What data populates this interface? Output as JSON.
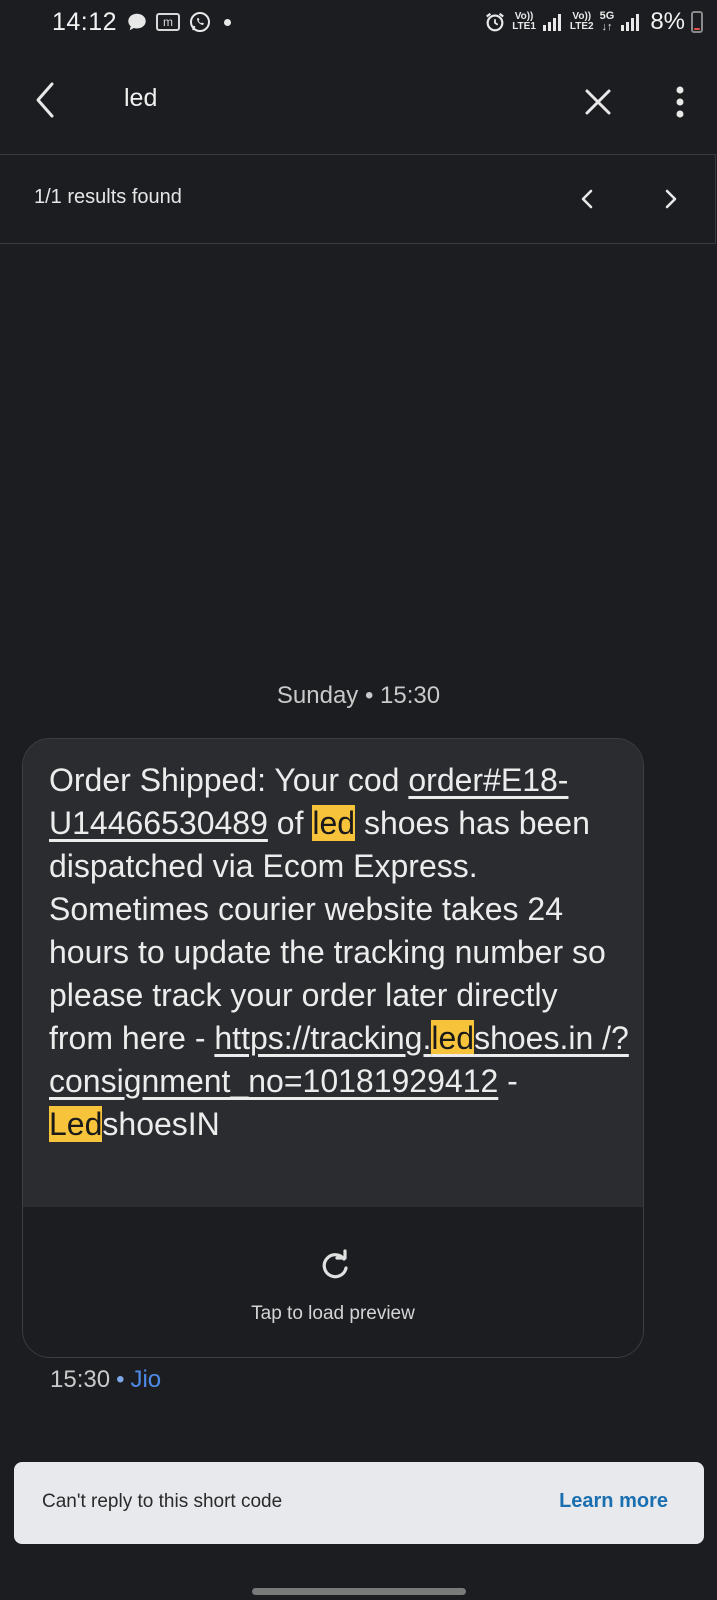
{
  "status_bar": {
    "time": "14:12",
    "msgm_label": "m",
    "net1_top": "Vo))",
    "net1_bottom": "LTE1",
    "net2_top": "Vo))",
    "net2_bottom": "LTE2",
    "net_5g": "5G",
    "net_5g_arrows": "↓↑",
    "battery_text": "8%",
    "battery_level_percent": 8,
    "battery_color": "#e8504a"
  },
  "search": {
    "query": "led"
  },
  "results": {
    "text": "1/1 results found"
  },
  "conversation": {
    "date_separator": "Sunday • 15:30",
    "message": {
      "p1": "Order Shipped: Your cod ",
      "link1": "order#E18-U14466530489",
      "p2": " of ",
      "hl1": "led",
      "p3": " shoes has been dispatched via Ecom Express. Sometimes courier website takes 24 hours to update the tracking number so please track your order later directly from here - ",
      "link2_a": "https://tracking.",
      "link2_hl": "led",
      "link2_b": "shoes.in /?consignment_no=10181929412",
      "p4": " - ",
      "hl2": "Led",
      "p5": "shoesIN"
    },
    "preview_label": "Tap to load preview",
    "meta_time": "15:30",
    "meta_sep": "•",
    "meta_sim": "Jio"
  },
  "notice": {
    "text": "Can't reply to this short code",
    "action": "Learn more"
  },
  "colors": {
    "background": "#1c1d20",
    "bubble": "#2b2c30",
    "highlight": "#f6c33b",
    "link_accent": "#1a6fb0",
    "sim_label": "#4d8ae8"
  },
  "icons": {
    "back": "arrow-left-icon",
    "clear": "close-icon",
    "more": "more-vert-icon",
    "prev": "chevron-left-icon",
    "next": "chevron-right-icon",
    "refresh": "refresh-icon"
  }
}
